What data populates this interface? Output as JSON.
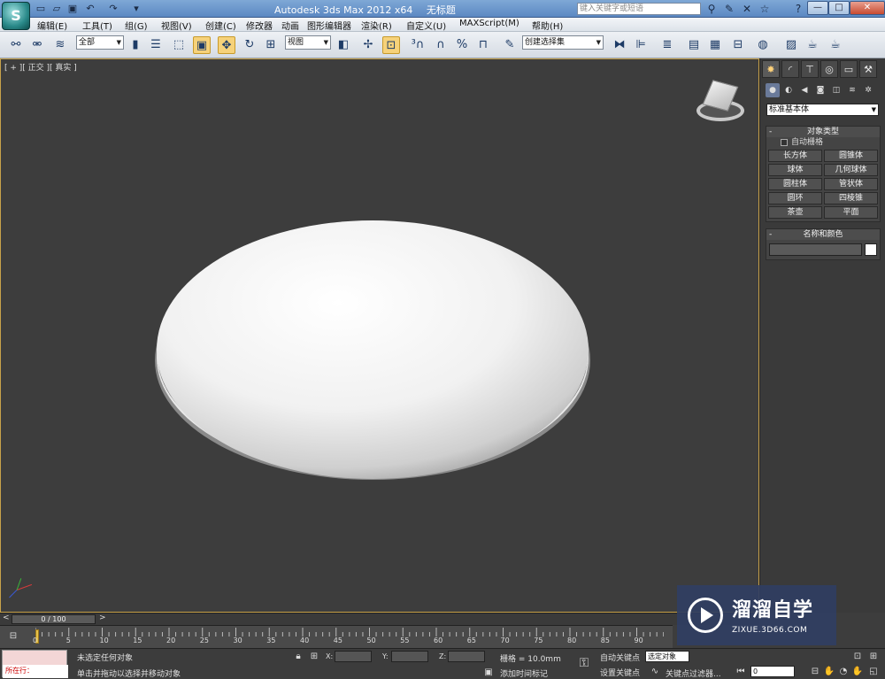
{
  "window": {
    "title_app": "Autodesk 3ds Max  2012 x64",
    "title_file": "无标题",
    "search_placeholder": "键入关键字或短语",
    "app_logo": "S"
  },
  "menu": {
    "items": [
      "编辑(E)",
      "工具(T)",
      "组(G)",
      "视图(V)",
      "创建(C)",
      "修改器",
      "动画",
      "图形编辑器",
      "渲染(R)",
      "自定义(U)",
      "MAXScript(M)",
      "帮助(H)"
    ]
  },
  "toolbar": {
    "selection_filter": "全部",
    "reference_coord": "视图",
    "named_selection": "创建选择集"
  },
  "viewport": {
    "label": "[ + ][ 正交 ][ 真实 ]"
  },
  "command_panel": {
    "category_dropdown": "标准基本体",
    "object_type_title": "对象类型",
    "autogrid_label": "自动栅格",
    "object_buttons": [
      "长方体",
      "圆锥体",
      "球体",
      "几何球体",
      "圆柱体",
      "管状体",
      "圆环",
      "四棱锥",
      "茶壶",
      "平面"
    ],
    "name_color_title": "名称和颜色",
    "rollout_toggle": "-"
  },
  "timeline": {
    "slider_label": "0 / 100",
    "ticks": [
      "0",
      "5",
      "10",
      "15",
      "20",
      "25",
      "30",
      "35",
      "40",
      "45",
      "50",
      "55",
      "60",
      "65",
      "70",
      "75",
      "80",
      "85",
      "90"
    ]
  },
  "status": {
    "maxscript_running": "所在行：",
    "selection_status": "未选定任何对象",
    "prompt": "单击并拖动以选择并移动对象",
    "x_label": "X:",
    "y_label": "Y:",
    "z_label": "Z:",
    "grid": "栅格 = 10.0mm",
    "add_time_tag": "添加时间标记",
    "auto_key": "自动关键点",
    "set_key": "设置关键点",
    "selected_field": "选定对象",
    "key_filters": "关键点过滤器...",
    "frame_field": "0"
  },
  "watermark": {
    "title": "溜溜自学",
    "url": "ZIXUE.3D66.COM"
  },
  "colors": {
    "viewport_bg": "#3d3d3d",
    "viewport_border": "#c8a24a",
    "titlebar": "#6a96cc",
    "active_tool": "#f6d27a"
  }
}
